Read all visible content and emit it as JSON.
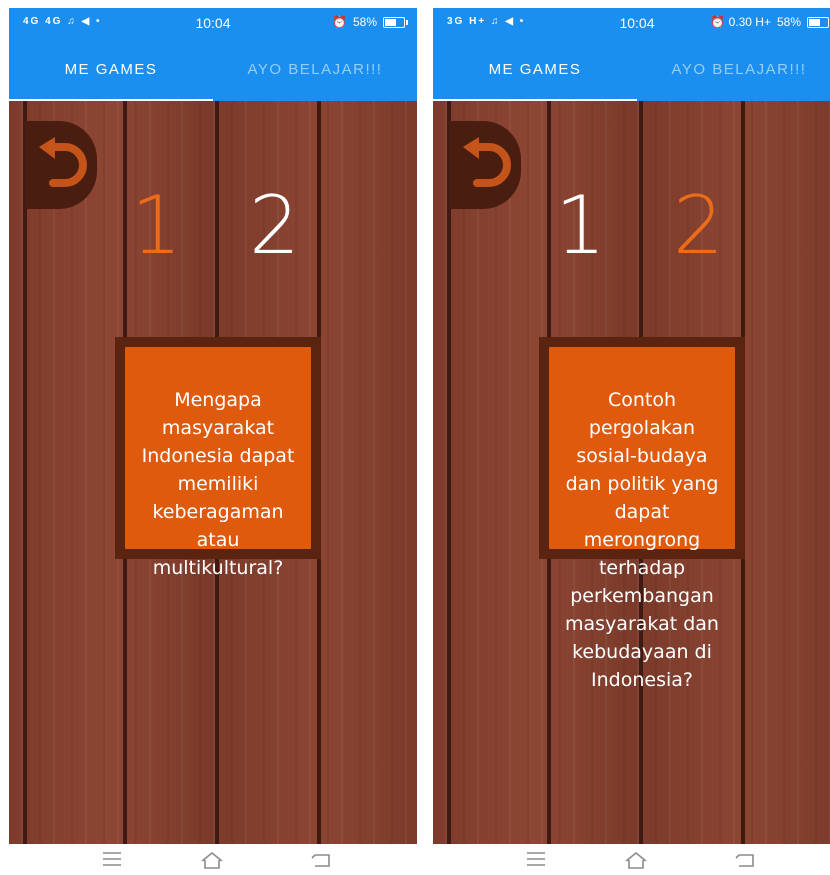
{
  "screens": [
    {
      "status": {
        "left": "4G 4G ♫ ◀ •",
        "time": "10:04",
        "right": "⏰",
        "battery_text": "58%",
        "battery_level": 0.58
      },
      "tabs": [
        {
          "label": "ME GAMES",
          "active": true
        },
        {
          "label": "AYO BELAJAR!!!",
          "active": false
        }
      ],
      "numbers": [
        {
          "label": "1",
          "color": "#ec6c1a"
        },
        {
          "label": "2",
          "color": "#ffffff"
        }
      ],
      "question": "Mengapa\nmasyarakat\nIndonesia dapat\nmemiliki\nkeberagaman\natau\nmultikultural?"
    },
    {
      "status": {
        "left": "3G H+ ♫ ◀ •",
        "time": "10:04",
        "right": "⏰ 0.30 H+",
        "battery_text": "58%",
        "battery_level": 0.58
      },
      "tabs": [
        {
          "label": "ME GAMES",
          "active": true
        },
        {
          "label": "AYO BELAJAR!!!",
          "active": false
        }
      ],
      "numbers": [
        {
          "label": "1",
          "color": "#ffffff"
        },
        {
          "label": "2",
          "color": "#ec6c1a"
        }
      ],
      "question": "Contoh\npergolakan\nsosial-budaya\ndan politik yang\ndapat\nmerongrong\nterhadap\nperkembangan\nmasyarakat dan\nkebudayaan di\nIndonesia?"
    }
  ],
  "colors": {
    "appbar": "#1a8ff0",
    "accent": "#ec6c1a",
    "card": "#df5a0c",
    "wood": "#7d3b2b"
  },
  "icons": {
    "back": "undo-arrow-icon",
    "nav_menu": "menu-lines-icon",
    "nav_home": "home-icon",
    "nav_back": "back-icon"
  }
}
